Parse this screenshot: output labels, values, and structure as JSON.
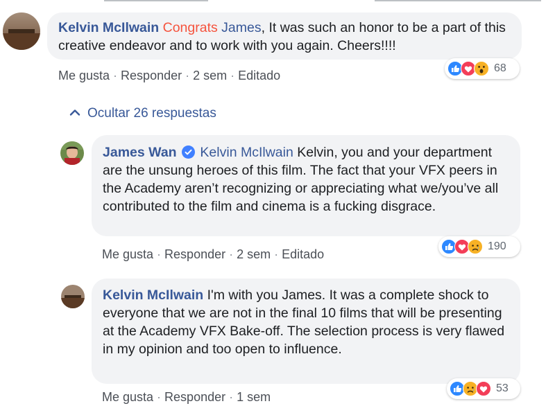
{
  "comment_main": {
    "author": "Kelvin McIlwain",
    "highlight": "Congrats",
    "mention": "James",
    "text": ", It was such an honor to be a part of this creative endeavor and to work with you again. Cheers!!!!",
    "actions": {
      "like": "Me gusta",
      "reply": "Responder",
      "time": "2 sem",
      "edited": "Editado"
    },
    "reactions": {
      "icons": [
        "like-icon",
        "love-icon",
        "wow-icon"
      ],
      "count": "68"
    }
  },
  "replies_toggle": {
    "label": "Ocultar 26 respuestas"
  },
  "reply_1": {
    "author": "James Wan",
    "verified": true,
    "mention": "Kelvin McIlwain",
    "text": " Kelvin, you and your department are the unsung heroes of this film. The fact that your VFX peers in the Academy aren’t recognizing or appreciating what we/you’ve all contributed to the film and cinema is a fucking disgrace.",
    "actions": {
      "like": "Me gusta",
      "reply": "Responder",
      "time": "2 sem",
      "edited": "Editado"
    },
    "reactions": {
      "icons": [
        "like-icon",
        "love-icon",
        "sad-icon"
      ],
      "count": "190"
    }
  },
  "reply_2": {
    "author": "Kelvin McIlwain",
    "text": " I'm with you James. It was a complete shock to everyone that we are not in the final 10 films that will be presenting at the Academy VFX Bake-off. The selection process is very flawed in my opinion and too open to influence.",
    "actions": {
      "like": "Me gusta",
      "reply": "Responder",
      "time": "1 sem"
    },
    "reactions": {
      "icons": [
        "like-icon",
        "sad-icon",
        "love-icon"
      ],
      "count": "53"
    }
  },
  "colors": {
    "link": "#385898",
    "bubble": "#f2f3f5",
    "accent": "#f5533d",
    "like": "#2d88ff",
    "love": "#f33e58",
    "emoji": "#f7b125"
  }
}
